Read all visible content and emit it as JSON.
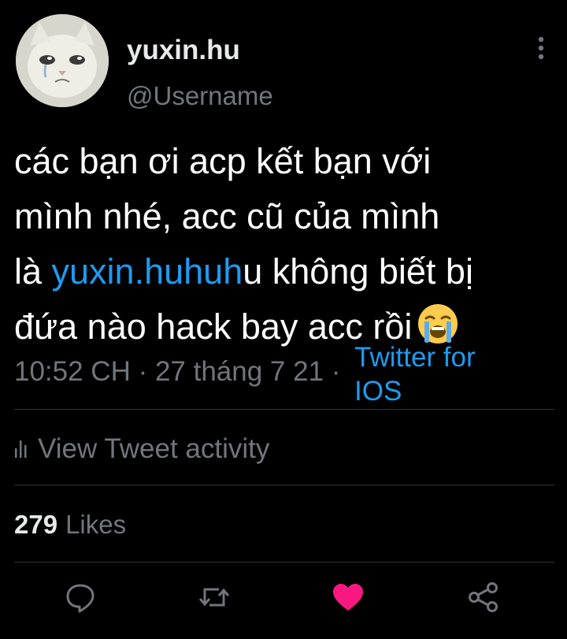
{
  "user": {
    "display_name": "yuxin.hu",
    "username": "@Username"
  },
  "tweet": {
    "line1": "các bạn ơi acp kết bạn với",
    "line2": "mình nhé,  acc cũ của mình",
    "line3_prefix": "là ",
    "mention": "yuxin.huhuh",
    "line3_suffix": "u không biết bị",
    "line4": "đứa nào hack bay acc rồi",
    "emoji": "loudly-crying-face-emoji"
  },
  "meta": {
    "time": "10:52 CH · 27 tháng 7 21 ·",
    "source": "Twitter for IOS"
  },
  "activity_label": "View Tweet activity",
  "likes": {
    "count": "279",
    "label": "Likes"
  },
  "colors": {
    "background": "#000000",
    "accent": "#1d9bf0",
    "muted": "#71767b",
    "like": "#f91880"
  },
  "icons": [
    "more-vertical-icon",
    "activity-bars-icon",
    "reply-icon",
    "retweet-icon",
    "heart-icon",
    "share-icon"
  ]
}
